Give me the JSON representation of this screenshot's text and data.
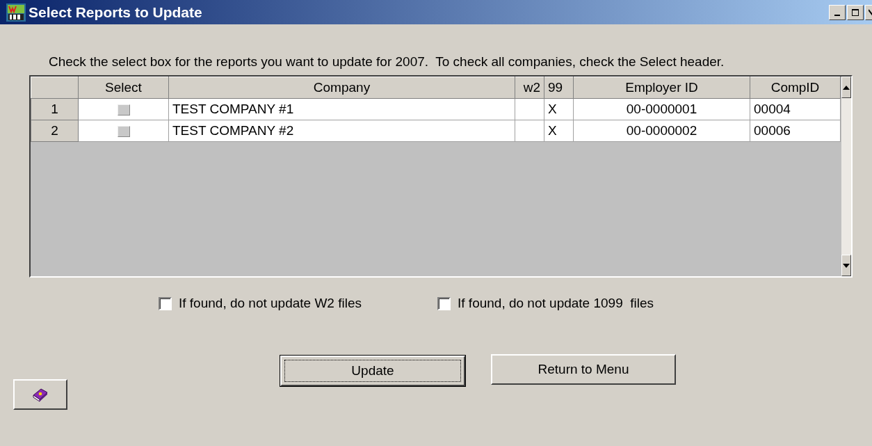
{
  "window": {
    "title": "Select Reports to Update"
  },
  "instruction": "Check the select box for the reports you want to update for 2007.  To check all companies, check the Select header.",
  "table": {
    "columns": [
      "Select",
      "Company",
      "w2",
      "99",
      "Employer ID",
      "CompID"
    ],
    "rows": [
      {
        "number": "1",
        "cells": [
          {
            "checked": false
          },
          "TEST COMPANY #1",
          "",
          "X",
          "00-0000001",
          "00004"
        ]
      },
      {
        "number": "2",
        "cells": [
          {
            "checked": false
          },
          "TEST COMPANY #2",
          "",
          "X",
          "00-0000002",
          "00006"
        ]
      }
    ]
  },
  "options": [
    {
      "label": "If found, do not update W2 files",
      "checked": false
    },
    {
      "label": "If found, do not update 1099  files",
      "checked": false
    }
  ],
  "buttons": [
    {
      "label": "Update",
      "focused": true
    },
    {
      "label": "Return to Menu",
      "focused": false
    }
  ]
}
